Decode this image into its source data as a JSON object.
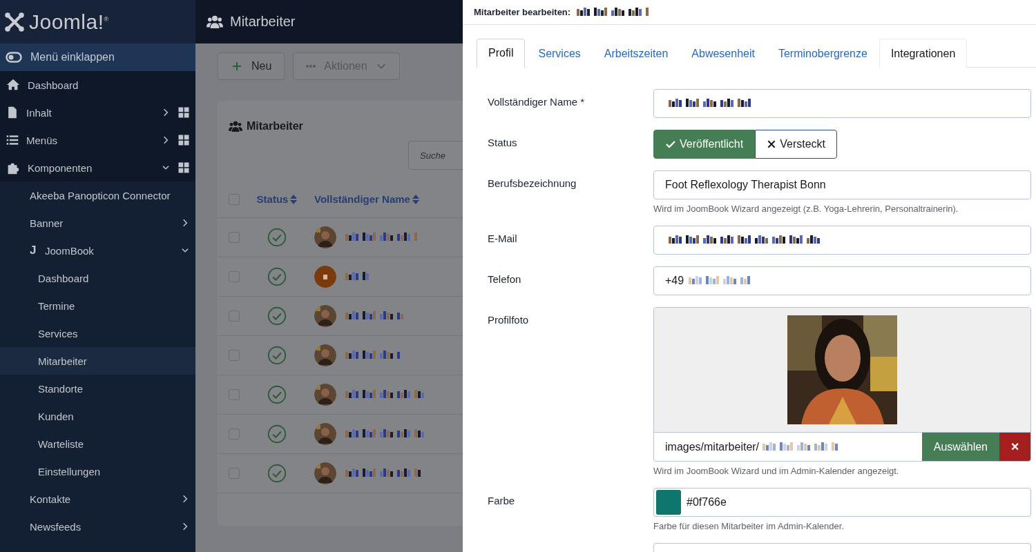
{
  "logo": {
    "text": "Joomla!",
    "mark": "®"
  },
  "header": {
    "title": "Mitarbeiter"
  },
  "sidebar": {
    "collapse": "Menü einklappen",
    "items": [
      {
        "label": "Dashboard",
        "grid": false,
        "selected": false
      },
      {
        "label": "Inhalt",
        "grid": true,
        "expanded": false,
        "selected": false
      },
      {
        "label": "Menüs",
        "grid": true,
        "expanded": false,
        "selected": false
      },
      {
        "label": "Komponenten",
        "grid": true,
        "expanded": true,
        "selected": false,
        "children": [
          {
            "label": "Akeeba Panopticon Connector",
            "selected": false
          },
          {
            "label": "Banner",
            "expanded": false,
            "selected": false
          },
          {
            "label": "JoomBook",
            "icon_text": "J",
            "expanded": true,
            "selected": false,
            "children": [
              {
                "label": "Dashboard",
                "selected": false
              },
              {
                "label": "Termine",
                "selected": false
              },
              {
                "label": "Services",
                "selected": false
              },
              {
                "label": "Mitarbeiter",
                "selected": true
              },
              {
                "label": "Standorte",
                "selected": false
              },
              {
                "label": "Kunden",
                "selected": false
              },
              {
                "label": "Warteliste",
                "selected": false
              },
              {
                "label": "Einstellungen",
                "selected": false
              }
            ]
          },
          {
            "label": "Kontakte",
            "expanded": false,
            "selected": false
          },
          {
            "label": "Newsfeeds",
            "expanded": false,
            "selected": false
          }
        ]
      }
    ]
  },
  "toolbar": [
    {
      "label": "Neu",
      "kind": "new",
      "disabled": false
    },
    {
      "label": "Aktionen",
      "kind": "dropdown",
      "disabled": true
    }
  ],
  "card": {
    "title": "Mitarbeiter",
    "search": {
      "placeholder": "Suche"
    },
    "columns": [
      "Status",
      "Vollständiger Name"
    ],
    "all_checked": false,
    "rows": [
      {
        "checked": false,
        "published": true
      },
      {
        "checked": false,
        "published": true,
        "color": "#7a3a0e"
      },
      {
        "checked": false,
        "published": true
      },
      {
        "checked": false,
        "published": true
      },
      {
        "checked": false,
        "published": true
      },
      {
        "checked": false,
        "published": true
      },
      {
        "checked": false,
        "published": true
      }
    ]
  },
  "modal": {
    "title": "Mitarbeiter bearbeiten:",
    "tabs": [
      {
        "label": "Profil",
        "selected": true,
        "hovered": false
      },
      {
        "label": "Services",
        "selected": false,
        "hovered": false
      },
      {
        "label": "Arbeitszeiten",
        "selected": false,
        "hovered": false
      },
      {
        "label": "Abwesenheit",
        "selected": false,
        "hovered": false
      },
      {
        "label": "Terminobergrenze",
        "selected": false,
        "hovered": false
      },
      {
        "label": "Integrationen",
        "selected": false,
        "hovered": true
      }
    ],
    "fields": [
      {
        "kind": "text",
        "label": "Vollständiger Name *",
        "redacted": true
      },
      {
        "kind": "toggle",
        "label": "Status",
        "options": [
          {
            "label": "Veröffentlicht",
            "selected": true
          },
          {
            "label": "Versteckt",
            "selected": false
          }
        ]
      },
      {
        "kind": "text",
        "label": "Berufsbezeichnung",
        "value": "Foot Reflexology Therapist Bonn",
        "hint": "Wird im JoomBook Wizard angezeigt (z.B. Yoga-Lehrerin, Personaltrainerin).",
        "redacted": false
      },
      {
        "kind": "text",
        "label": "E-Mail",
        "redacted": true
      },
      {
        "kind": "text",
        "label": "Telefon",
        "value": "+49",
        "redacted": true
      },
      {
        "label": "Profilfoto",
        "value": "images/mitarbeiter/",
        "button": "Auswählen",
        "clear": "×",
        "hint": "Wird im JoomBook Wizard und im Admin-Kalender angezeigt."
      },
      {
        "kind": "color",
        "label": "Farbe",
        "value": "#0f766e",
        "hint": "Farbe für diesen Mitarbeiter im Admin-Kalender."
      },
      {
        "kind": "text"
      }
    ]
  }
}
